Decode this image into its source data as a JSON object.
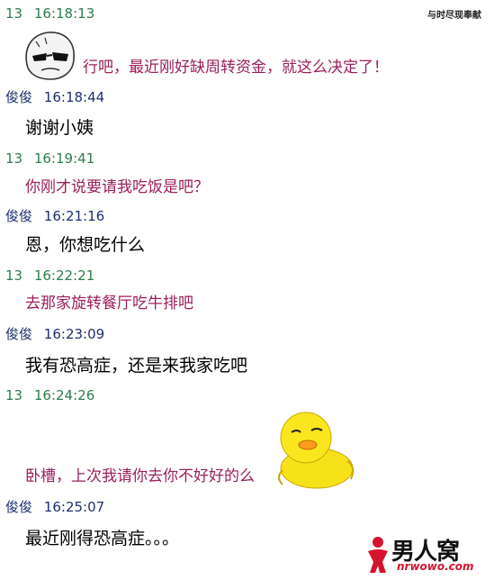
{
  "watermark_top": "与时尽现奉献",
  "messages": [
    {
      "sender": "13",
      "time": "16:18:13",
      "text": "行吧，最近刚好缺周转资金，就这么决定了！",
      "side": "them",
      "sticker": "sunglasses-face"
    },
    {
      "sender": "俊俊",
      "time": "16:18:44",
      "text": "谢谢小姨",
      "side": "me"
    },
    {
      "sender": "13",
      "time": "16:19:41",
      "text": "你刚才说要请我吃饭是吧？",
      "side": "them"
    },
    {
      "sender": "俊俊",
      "time": "16:21:16",
      "text": "恩，你想吃什么",
      "side": "me"
    },
    {
      "sender": "13",
      "time": "16:22:21",
      "text": "去那家旋转餐厅吃牛排吧",
      "side": "them"
    },
    {
      "sender": "俊俊",
      "time": "16:23:09",
      "text": "我有恐高症，还是来我家吃吧",
      "side": "me"
    },
    {
      "sender": "13",
      "time": "16:24:26",
      "text": "卧槽，上次我请你去你不好好的么",
      "side": "them",
      "sticker": "yellow-chick"
    },
    {
      "sender": "俊俊",
      "time": "16:25:07",
      "text": "最近刚得恐高症。。。",
      "side": "me"
    }
  ],
  "logo": {
    "name": "男人窝",
    "url": "nrwowo.com"
  },
  "colors": {
    "them_header": "#2e7d4f",
    "me_header": "#1d2f6e",
    "them_text": "#9b1f5c",
    "me_text": "#000000",
    "logo_red": "#d4142c"
  }
}
